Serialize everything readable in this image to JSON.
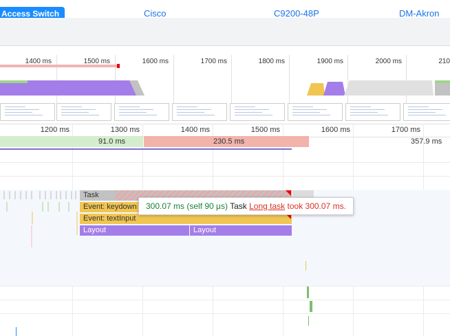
{
  "table_row": {
    "badge": "Access Switch",
    "cells": [
      "Cisco",
      "C9200-48P",
      "DM-Akron"
    ]
  },
  "overview_ruler": {
    "ticks": [
      "1400 ms",
      "1500 ms",
      "1600 ms",
      "1700 ms",
      "1800 ms",
      "1900 ms",
      "2000 ms",
      "210"
    ]
  },
  "main_ruler": {
    "ticks": [
      "1200 ms",
      "1300 ms",
      "1400 ms",
      "1500 ms",
      "1600 ms",
      "1700 ms"
    ]
  },
  "frames": [
    {
      "label": "91.0 ms"
    },
    {
      "label": "230.5 ms"
    },
    {
      "label": "357.9 ms"
    }
  ],
  "flame": {
    "task": "Task",
    "keydown": "Event: keydown",
    "textinput": "Event: textInput",
    "layout1": "Layout",
    "layout2": "Layout"
  },
  "tooltip": {
    "time": "300.07 ms (self 90 μs)",
    "name": "Task",
    "link": "Long task",
    "rest": "took 300.07 ms."
  },
  "colors": {
    "badge": "#1a8cff",
    "link": "#1a73e8",
    "task": "#c2c2c2",
    "event": "#f0c552",
    "layout": "#a47ee8",
    "long_task_red": "#d93025",
    "time_green": "#188038"
  }
}
